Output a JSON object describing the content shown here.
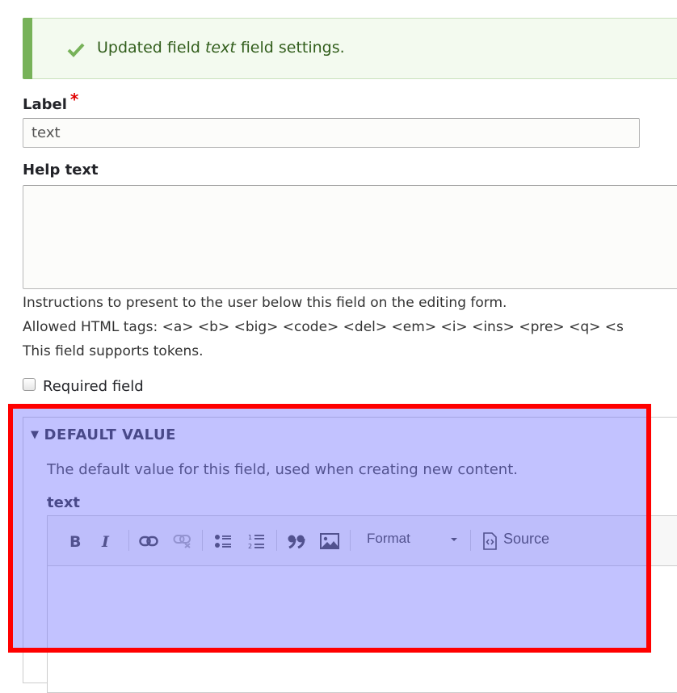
{
  "status_message": {
    "prefix": "Updated field ",
    "field_name": "text",
    "suffix": " field settings.",
    "icon": "check-icon",
    "accent_color": "#77b259"
  },
  "label_field": {
    "label": "Label",
    "required_marker": "*",
    "value": "text"
  },
  "help_text_field": {
    "label": "Help text",
    "value": "",
    "descriptions": [
      "Instructions to present to the user below this field on the editing form.",
      "Allowed HTML tags: <a> <b> <big> <code> <del> <em> <i> <ins> <pre> <q> <s",
      "This field supports tokens."
    ]
  },
  "required_checkbox": {
    "label": "Required field",
    "checked": false
  },
  "default_value": {
    "summary": "DEFAULT VALUE",
    "expanded": true,
    "description": "The default value for this field, used when creating new content.",
    "field_label": "text",
    "editor": {
      "toolbar": [
        {
          "name": "bold",
          "icon": "bold-icon"
        },
        {
          "name": "italic",
          "icon": "italic-icon"
        },
        {
          "name": "link",
          "icon": "link-icon"
        },
        {
          "name": "unlink",
          "icon": "unlink-icon",
          "disabled": true
        },
        {
          "name": "bulleted-list",
          "icon": "bulleted-list-icon"
        },
        {
          "name": "numbered-list",
          "icon": "numbered-list-icon"
        },
        {
          "name": "blockquote",
          "icon": "blockquote-icon"
        },
        {
          "name": "image",
          "icon": "image-icon"
        }
      ],
      "format_label": "Format",
      "source_label": "Source",
      "content": ""
    }
  },
  "highlight": {
    "border_color": "#ff0000",
    "fill_color": "#7878ff"
  }
}
